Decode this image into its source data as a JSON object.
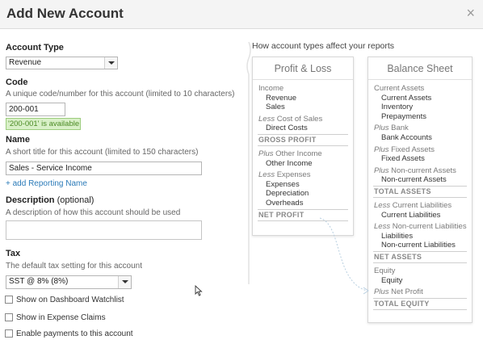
{
  "dialog": {
    "title": "Add New Account",
    "close_label": "×"
  },
  "form": {
    "account_type": {
      "label": "Account Type",
      "value": "Revenue"
    },
    "code": {
      "label": "Code",
      "hint": "A unique code/number for this account (limited to 10 characters)",
      "value": "200-001",
      "availability": "'200-001' is available"
    },
    "name": {
      "label": "Name",
      "hint": "A short title for this account (limited to 150 characters)",
      "value": "Sales - Service Income",
      "add_reporting_name": "+ add Reporting Name"
    },
    "description": {
      "label": "Description",
      "optional": "(optional)",
      "hint": "A description of how this account should be used",
      "value": ""
    },
    "tax": {
      "label": "Tax",
      "hint": "The default tax setting for this account",
      "value": "SST @ 8% (8%)"
    },
    "checkboxes": [
      {
        "label": "Show on Dashboard Watchlist",
        "checked": false
      },
      {
        "label": "Show in Expense Claims",
        "checked": false
      },
      {
        "label": "Enable payments to this account",
        "checked": false
      }
    ]
  },
  "reports": {
    "title": "How account types affect your reports",
    "profit_loss": {
      "title": "Profit & Loss",
      "rows": [
        {
          "text": "Income",
          "style": "head"
        },
        {
          "text": "Revenue",
          "style": "item"
        },
        {
          "text": "Sales",
          "style": "item"
        },
        {
          "italic": "Less",
          "text": "Cost of Sales",
          "style": "head"
        },
        {
          "text": "Direct Costs",
          "style": "item"
        },
        {
          "text": "GROSS PROFIT",
          "style": "section"
        },
        {
          "italic": "Plus",
          "text": "Other Income",
          "style": "head"
        },
        {
          "text": "Other Income",
          "style": "item"
        },
        {
          "italic": "Less",
          "text": "Expenses",
          "style": "head"
        },
        {
          "text": "Expenses",
          "style": "item"
        },
        {
          "text": "Depreciation",
          "style": "item"
        },
        {
          "text": "Overheads",
          "style": "item"
        },
        {
          "text": "NET PROFIT",
          "style": "section"
        }
      ]
    },
    "balance_sheet": {
      "title": "Balance Sheet",
      "rows": [
        {
          "text": "Current Assets",
          "style": "head"
        },
        {
          "text": "Current Assets",
          "style": "item"
        },
        {
          "text": "Inventory",
          "style": "item"
        },
        {
          "text": "Prepayments",
          "style": "item"
        },
        {
          "italic": "Plus",
          "text": "Bank",
          "style": "head"
        },
        {
          "text": "Bank Accounts",
          "style": "item"
        },
        {
          "italic": "Plus",
          "text": "Fixed Assets",
          "style": "head"
        },
        {
          "text": "Fixed Assets",
          "style": "item"
        },
        {
          "italic": "Plus",
          "text": "Non-current Assets",
          "style": "head"
        },
        {
          "text": "Non-current Assets",
          "style": "item"
        },
        {
          "text": "TOTAL ASSETS",
          "style": "section"
        },
        {
          "italic": "Less",
          "text": "Current Liabilities",
          "style": "head"
        },
        {
          "text": "Current Liabilities",
          "style": "item"
        },
        {
          "italic": "Less",
          "text": "Non-current Liabilities",
          "style": "head"
        },
        {
          "text": "Liabilities",
          "style": "item"
        },
        {
          "text": "Non-current Liabilities",
          "style": "item"
        },
        {
          "text": "NET ASSETS",
          "style": "section"
        },
        {
          "text": "Equity",
          "style": "head"
        },
        {
          "text": "Equity",
          "style": "item"
        },
        {
          "italic": "Plus",
          "text": "Net Profit",
          "style": "head"
        },
        {
          "text": "TOTAL EQUITY",
          "style": "section"
        }
      ]
    }
  },
  "colors": {
    "link": "#2a7ab8",
    "available_bg": "#d9f0c8",
    "available_text": "#4a8a23"
  }
}
